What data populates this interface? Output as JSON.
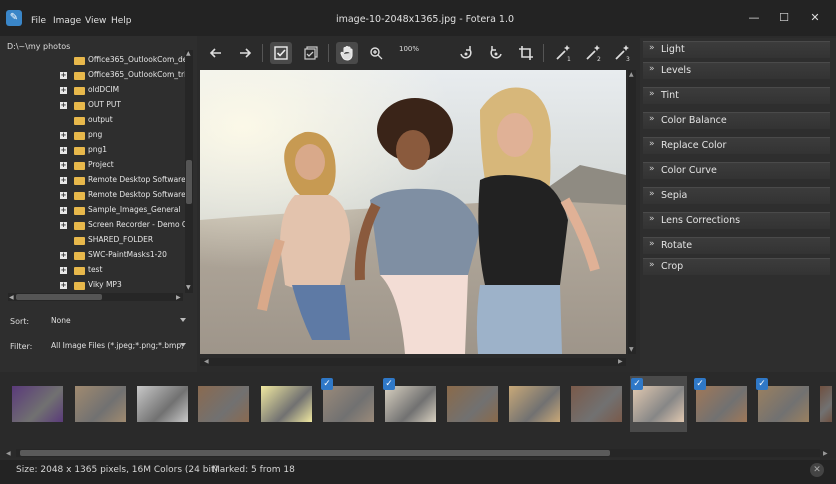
{
  "window": {
    "title": "image-10-2048x1365.jpg - Fotera 1.0"
  },
  "menu": [
    "File",
    "Image",
    "View",
    "Help"
  ],
  "browser": {
    "path": "D:\\~\\my photos",
    "tree": [
      {
        "label": "Office365_OutlookCom_de",
        "expandable": false
      },
      {
        "label": "Office365_OutlookCom_tri",
        "expandable": true
      },
      {
        "label": "oldDCIM",
        "expandable": true
      },
      {
        "label": "OUT PUT",
        "expandable": true
      },
      {
        "label": "output",
        "expandable": false
      },
      {
        "label": "png",
        "expandable": true
      },
      {
        "label": "png1",
        "expandable": true
      },
      {
        "label": "Project",
        "expandable": true
      },
      {
        "label": "Remote Desktop Software",
        "expandable": true
      },
      {
        "label": "Remote Desktop Software",
        "expandable": true
      },
      {
        "label": "Sample_Images_General",
        "expandable": true
      },
      {
        "label": "Screen Recorder - Demo C",
        "expandable": true
      },
      {
        "label": "SHARED_FOLDER",
        "expandable": false
      },
      {
        "label": "SWC-PaintMasks1-20",
        "expandable": true
      },
      {
        "label": "test",
        "expandable": true
      },
      {
        "label": "Viky MP3",
        "expandable": true
      }
    ],
    "sort_label": "Sort:",
    "sort_value": "None",
    "filter_label": "Filter:",
    "filter_value": "All Image Files (*.jpeg;*.png;*.bmp;"
  },
  "toolbar": {
    "zoom": "100%",
    "icons": [
      "back-arrow-icon",
      "forward-arrow-icon",
      "check-all-icon",
      "check-toggle-icon",
      "hand-icon",
      "zoom-icon",
      "rotate-left-icon",
      "rotate-right-icon",
      "crop-icon",
      "wand-1-icon",
      "wand-2-icon",
      "wand-3-icon"
    ]
  },
  "adjustments": [
    "Light",
    "Levels",
    "Tint",
    "Color Balance",
    "Replace Color",
    "Color Curve",
    "Sepia",
    "Lens Corrections",
    "Rotate",
    "Crop"
  ],
  "thumbnails": [
    {
      "checked": false,
      "selected": false,
      "color": "#5a3a7a"
    },
    {
      "checked": false,
      "selected": false,
      "color": "#a08a70"
    },
    {
      "checked": false,
      "selected": false,
      "color": "#c8c8c8"
    },
    {
      "checked": false,
      "selected": false,
      "color": "#8a6a50"
    },
    {
      "checked": false,
      "selected": false,
      "color": "#f0e8a0"
    },
    {
      "checked": true,
      "selected": false,
      "color": "#9a8a7a"
    },
    {
      "checked": true,
      "selected": false,
      "color": "#d8d0c0"
    },
    {
      "checked": false,
      "selected": false,
      "color": "#8a6a4a"
    },
    {
      "checked": false,
      "selected": false,
      "color": "#c8a878"
    },
    {
      "checked": false,
      "selected": false,
      "color": "#7a5a4a"
    },
    {
      "checked": true,
      "selected": true,
      "color": "#e0c8b0"
    },
    {
      "checked": true,
      "selected": false,
      "color": "#a07858"
    },
    {
      "checked": true,
      "selected": false,
      "color": "#9a8060"
    },
    {
      "checked": false,
      "selected": false,
      "color": "#705040"
    }
  ],
  "status": {
    "size": "Size: 2048 x 1365 pixels, 16M Colors (24 bit)",
    "marked": "Marked: 5 from 18"
  }
}
